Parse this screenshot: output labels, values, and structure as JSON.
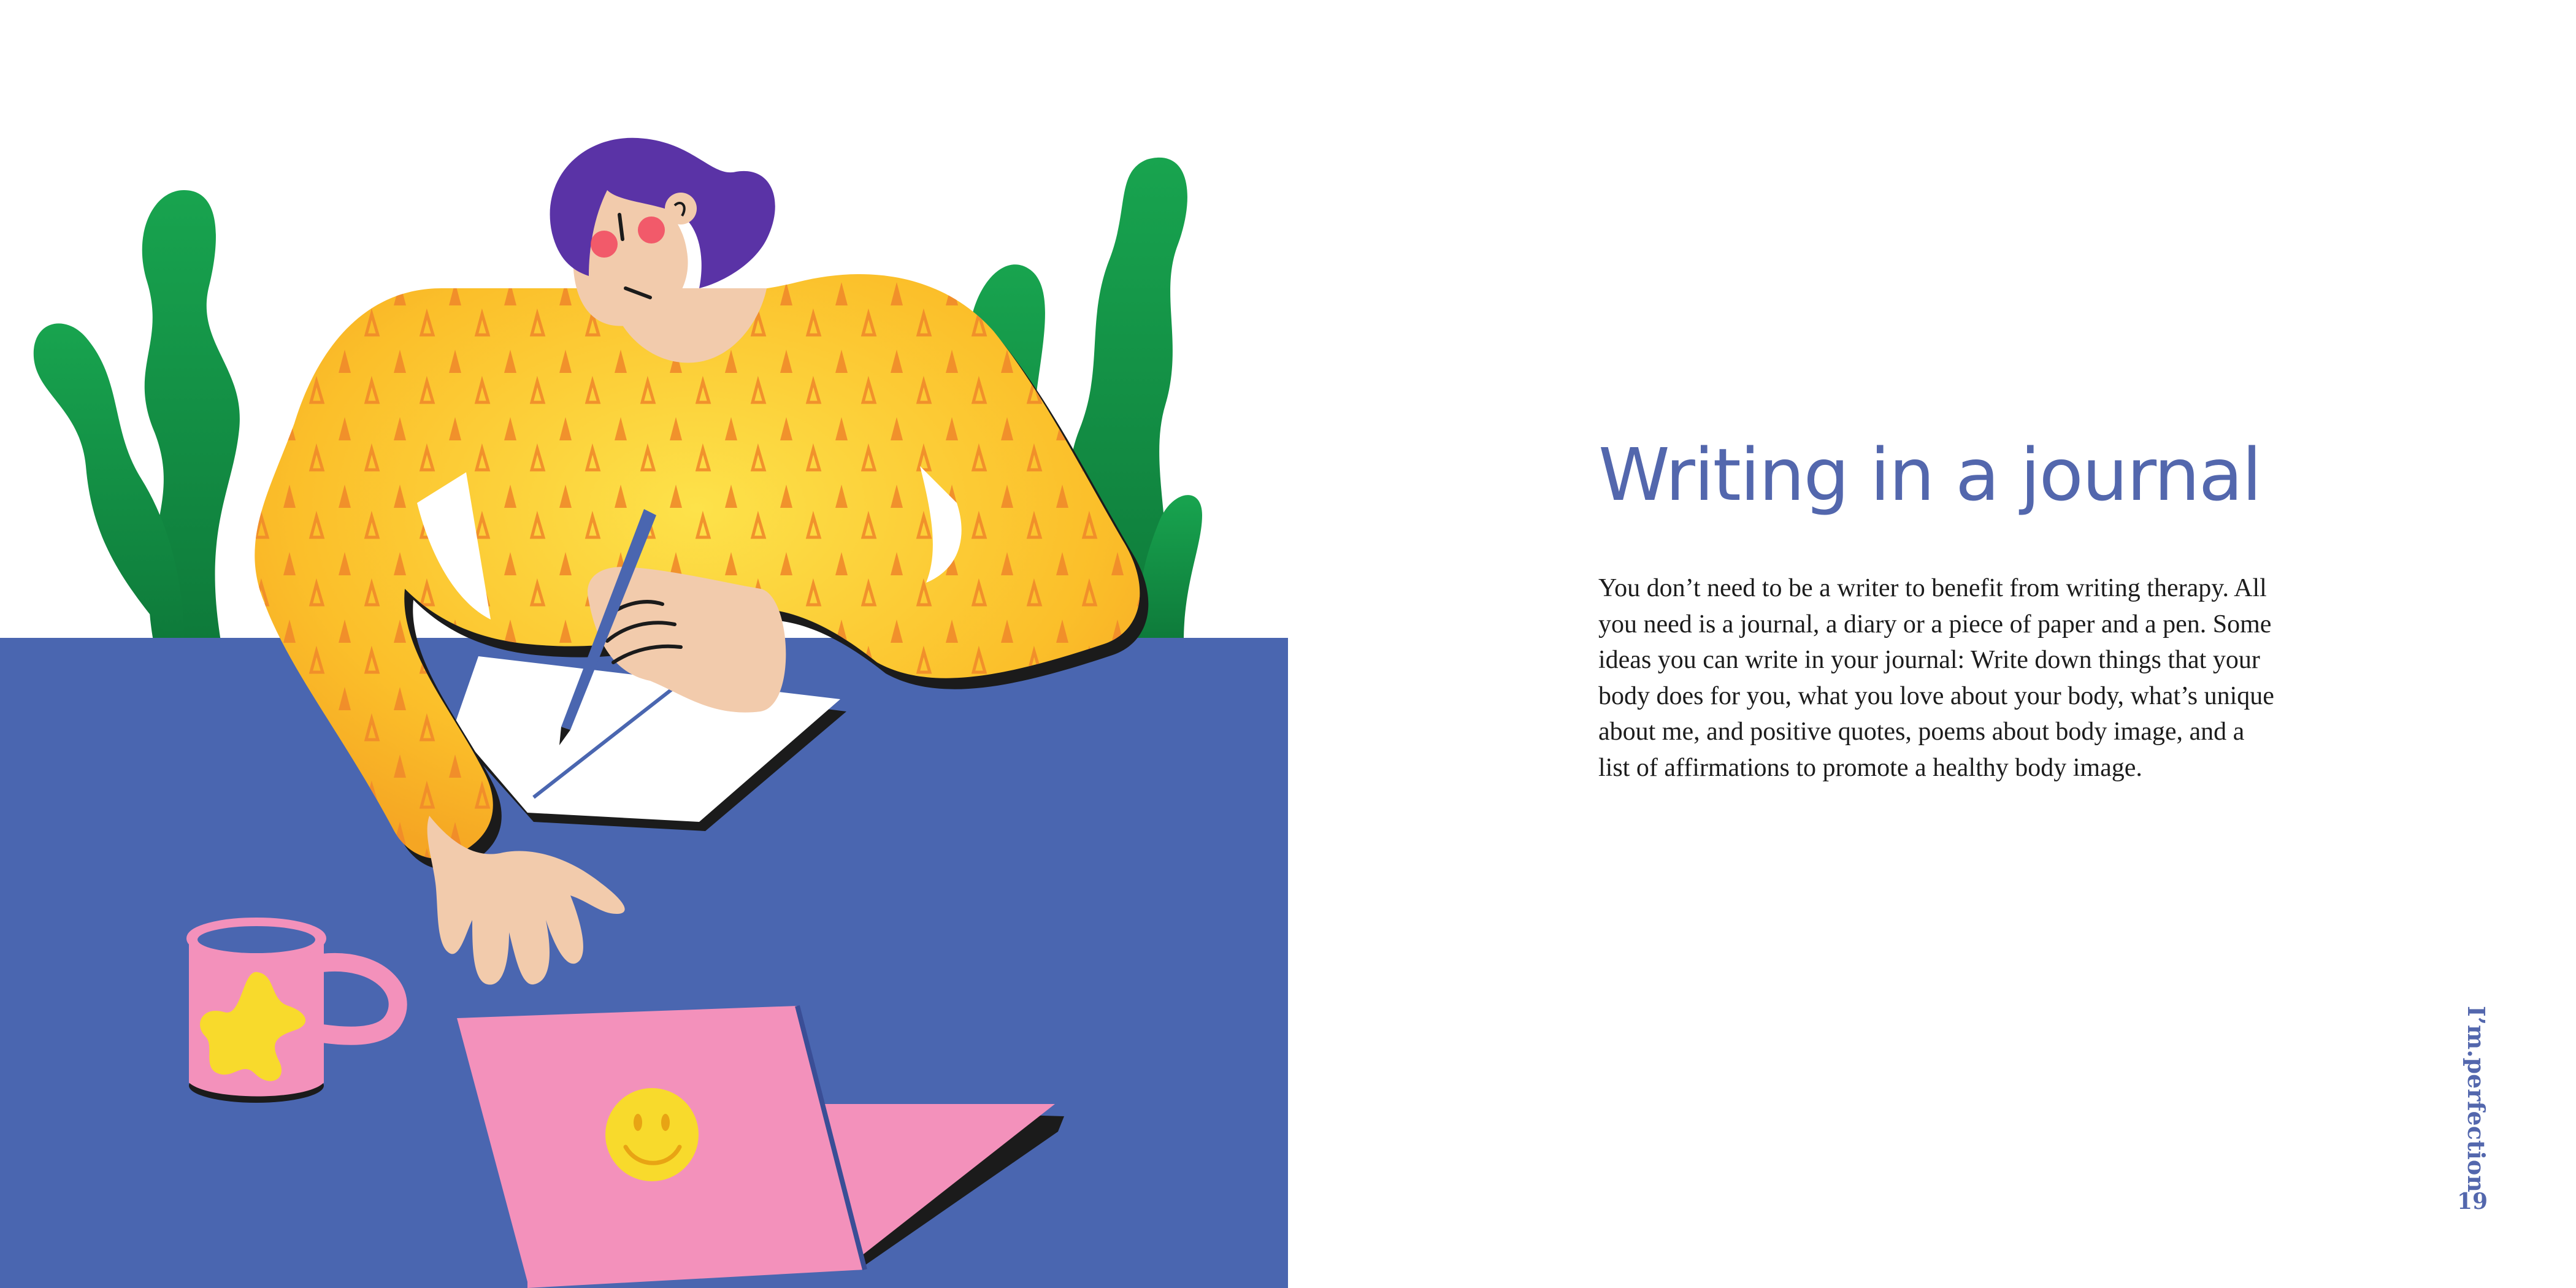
{
  "page": {
    "heading": "Writing in a journal",
    "body": "You don’t need to be a writer to benefit from writing therapy. All you need is a journal, a diary or a piece of paper and a pen. Some ideas you can write in your journal: Write down things that your body does for you, what you love about your body, what’s unique about me, and positive quotes, poems about body image, and a list of affirmations to promote a healthy body image.",
    "running_title": "I’m.perfection",
    "page_number": "19"
  },
  "colors": {
    "accent": "#5367ad",
    "table": "#4a66b0",
    "sweater": "#fbbf2a",
    "plant": "#16a050",
    "pink": "#f391bb",
    "skin": "#f2cbac",
    "hair": "#5a33a6"
  },
  "illustration": {
    "icons": [
      "plant-icon",
      "woman-icon",
      "mug-icon",
      "laptop-icon",
      "smiley-icon",
      "notebook-icon",
      "pen-icon"
    ]
  }
}
